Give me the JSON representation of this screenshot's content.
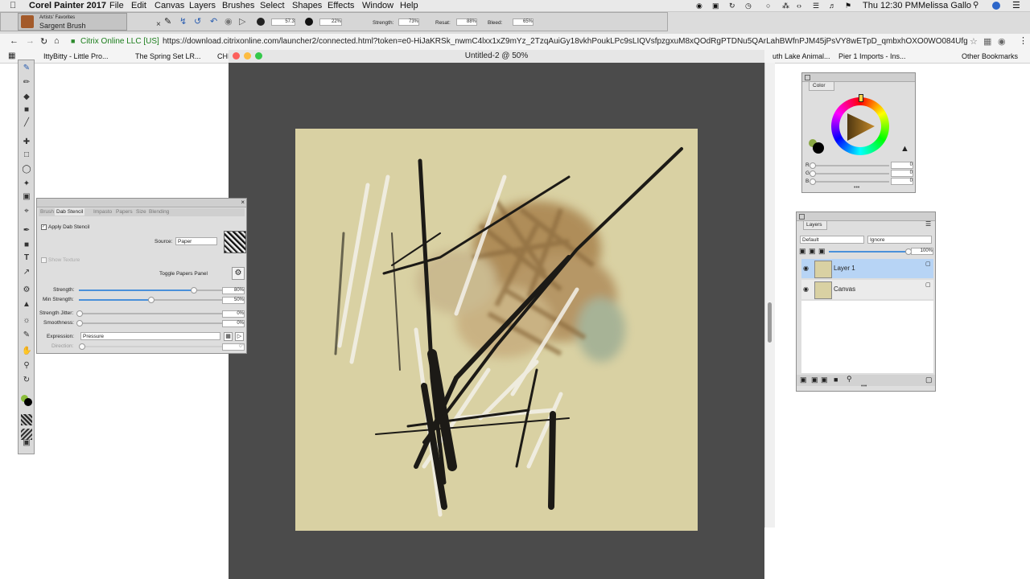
{
  "menubar": {
    "app_name": "Corel Painter 2017",
    "items": [
      "File",
      "Edit",
      "Canvas",
      "Layers",
      "Brushes",
      "Select",
      "Shapes",
      "Effects",
      "Window",
      "Help"
    ],
    "clock": "Thu 12:30 PM",
    "user": "Melissa Gallo"
  },
  "browser": {
    "site_label": "Citrix Online LLC [US]",
    "url": "https://download.citrixonline.com/launcher2/connected.html?token=e0-HiJaKRSk_nwmC4lxx1xZ9mYz_2TzqAuiGy18vkhPoukLPc9sLIQVsfpzgxuM8xQOdRgPTDNu5QArLahBWfnPJM45jPsVY8wETpD_qmbxhOXO0WO084UfgTip5I4...",
    "bookmarks": [
      "IttyBitty - Little Pro...",
      "The Spring Set LR...",
      "CHI",
      "uth Lake Animal...",
      "Pier 1 Imports - Ins...",
      "Other Bookmarks"
    ]
  },
  "painter": {
    "brush_category": "Artists' Favorites",
    "brush_variant": "Sargent Brush",
    "property_bar": {
      "size": "57.3",
      "opacity": "22%",
      "strength_label": "Strength:",
      "strength": "73%",
      "resat_label": "Resat:",
      "resat": "88%",
      "bleed_label": "Bleed:",
      "bleed": "65%"
    },
    "document_title": "Untitled-2 @ 50%"
  },
  "dab_panel": {
    "tabs": [
      "Brush",
      "Dab Stencil",
      "Impasto",
      "Papers",
      "Size",
      "Blending"
    ],
    "apply_label": "Apply Dab Stencil",
    "source_label": "Source:",
    "source_value": "Paper",
    "show_texture_label": "Show Texture",
    "toggle_label": "Toggle Papers Panel",
    "sliders": [
      {
        "label": "Strength:",
        "value": "80%",
        "level": 0.8
      },
      {
        "label": "Min Strength:",
        "value": "50%",
        "level": 0.5
      },
      {
        "label": "Strength Jitter:",
        "value": "0%",
        "level": 0
      },
      {
        "label": "Smoothness:",
        "value": "0%",
        "level": 0
      }
    ],
    "expression_label": "Expression:",
    "expression_value": "Pressure",
    "direction_label": "Direction:",
    "direction_value": "0°"
  },
  "color_panel": {
    "title": "Color",
    "rgb": [
      {
        "label": "R",
        "value": "0"
      },
      {
        "label": "G",
        "value": "0"
      },
      {
        "label": "B",
        "value": "0"
      }
    ],
    "accent": "#000000"
  },
  "layers_panel": {
    "title": "Layers",
    "composite_method": "Default",
    "composite_depth": "Ignore",
    "opacity": "100%",
    "layers": [
      {
        "name": "Layer 1",
        "selected": true
      },
      {
        "name": "Canvas",
        "selected": false
      }
    ]
  }
}
